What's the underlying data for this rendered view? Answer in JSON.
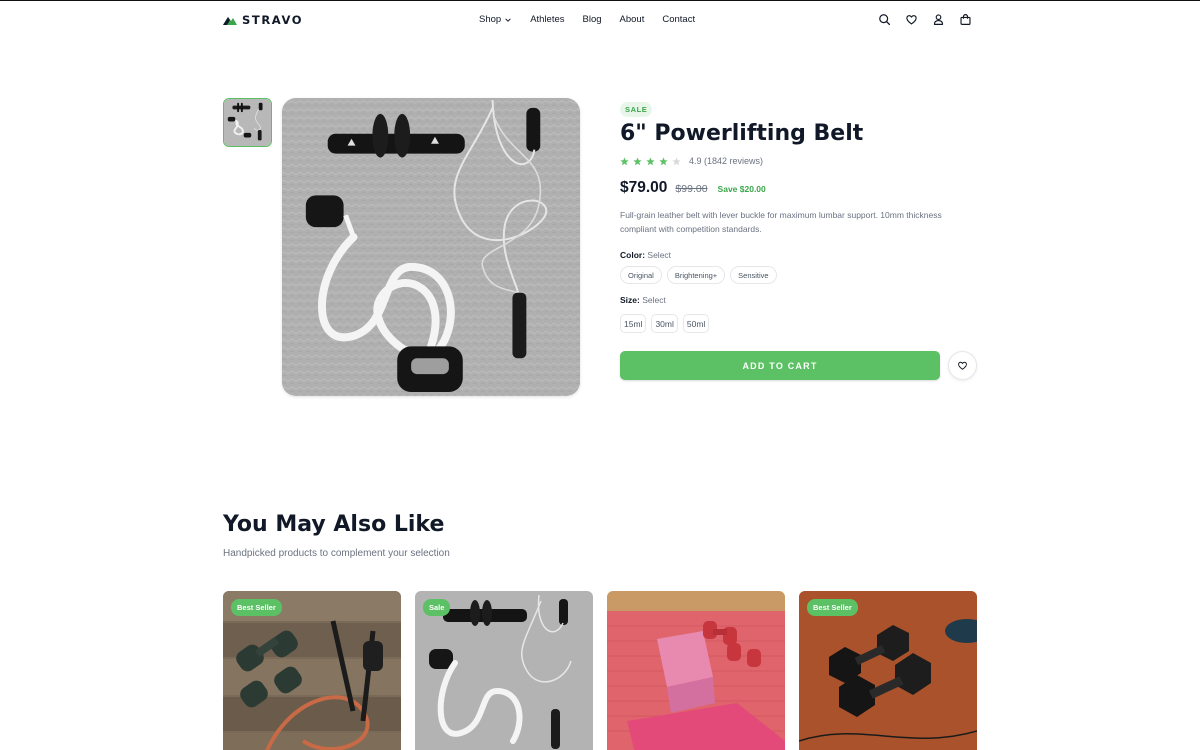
{
  "brand": {
    "name": "STRAVO",
    "accent": "#5cc064"
  },
  "nav": {
    "items": [
      {
        "label": "Shop",
        "has_dropdown": true
      },
      {
        "label": "Athletes"
      },
      {
        "label": "Blog"
      },
      {
        "label": "About"
      },
      {
        "label": "Contact"
      }
    ]
  },
  "header_icons": [
    "search-icon",
    "heart-icon",
    "user-icon",
    "bag-icon"
  ],
  "product": {
    "badge": "SALE",
    "title": "6\" Powerlifting Belt",
    "rating_text": "4.9 (1842 reviews)",
    "stars_filled": 4,
    "stars_total": 5,
    "price": "$79.00",
    "old_price": "$99.00",
    "save_text": "Save $20.00",
    "description": "Full-grain leather belt with lever buckle for maximum lumbar support. 10mm thickness compliant with competition standards.",
    "color": {
      "label": "Color:",
      "value": "Select",
      "options": [
        "Original",
        "Brightening+",
        "Sensitive"
      ]
    },
    "size": {
      "label": "Size:",
      "value": "Select",
      "options": [
        "15ml",
        "30ml",
        "50ml"
      ]
    },
    "add_to_cart": "ADD TO CART"
  },
  "recommendations": {
    "title": "You May Also Like",
    "subtitle": "Handpicked products to complement your selection",
    "cards": [
      {
        "badge": "Best Seller"
      },
      {
        "badge": "Sale"
      },
      {
        "badge": ""
      },
      {
        "badge": "Best Seller"
      }
    ]
  }
}
